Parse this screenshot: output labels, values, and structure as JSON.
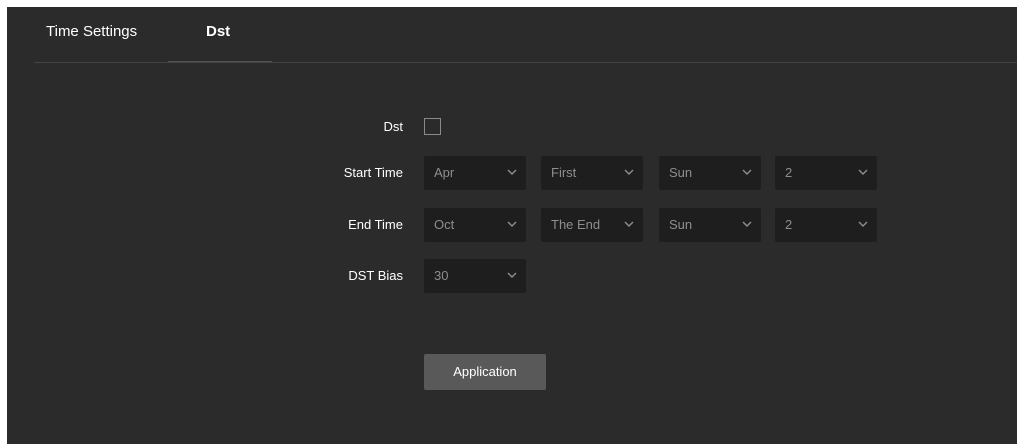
{
  "tabs": [
    "Time Settings",
    "Dst"
  ],
  "form": {
    "dst_label": "Dst",
    "dst_enabled": false,
    "start_label": "Start Time",
    "start": {
      "month": "Apr",
      "week": "First",
      "day": "Sun",
      "hour": "2"
    },
    "end_label": "End Time",
    "end": {
      "month": "Oct",
      "week": "The End",
      "day": "Sun",
      "hour": "2"
    },
    "bias_label": "DST Bias",
    "bias": "30"
  },
  "apply_label": "Application",
  "colors": {
    "accent": "#b3233a",
    "panel_bg": "#2b2b2b",
    "select_bg": "#1e1e1e",
    "button_bg": "#595959"
  }
}
